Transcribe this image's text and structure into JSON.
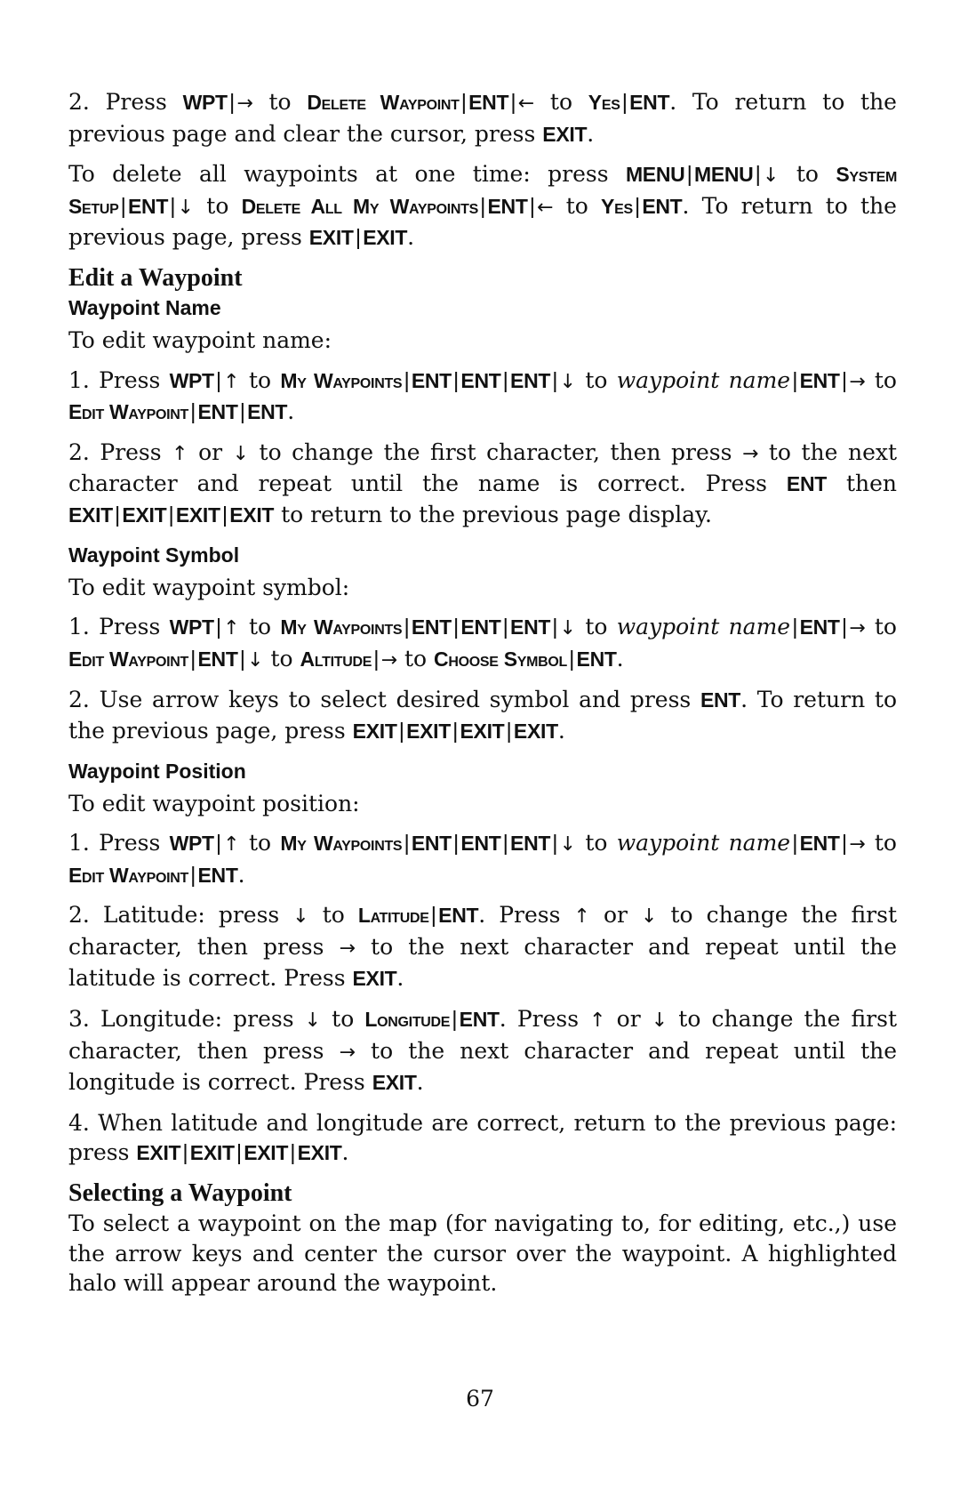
{
  "page_number": "67",
  "blocks": [
    {
      "type": "p",
      "runs": [
        [
          "t",
          "2. Press "
        ],
        [
          "k",
          "WPT"
        ],
        [
          "s"
        ],
        [
          "a",
          "→"
        ],
        [
          "t",
          " to "
        ],
        [
          "c",
          "Delete Waypoint"
        ],
        [
          "s"
        ],
        [
          "k",
          "ENT"
        ],
        [
          "s"
        ],
        [
          "a",
          "←"
        ],
        [
          "t",
          " to "
        ],
        [
          "c",
          "Yes"
        ],
        [
          "s"
        ],
        [
          "k",
          "ENT"
        ],
        [
          "t",
          ". To return to the previous page and clear the cursor, press "
        ],
        [
          "k",
          "EXIT"
        ],
        [
          "t",
          "."
        ]
      ]
    },
    {
      "type": "p",
      "runs": [
        [
          "t",
          "To delete all waypoints at one time: press "
        ],
        [
          "k",
          "MENU"
        ],
        [
          "s"
        ],
        [
          "k",
          "MENU"
        ],
        [
          "s"
        ],
        [
          "a",
          "↓"
        ],
        [
          "t",
          " to "
        ],
        [
          "c",
          "System Setup"
        ],
        [
          "s"
        ],
        [
          "k",
          "ENT"
        ],
        [
          "s"
        ],
        [
          "a",
          "↓"
        ],
        [
          "t",
          " to "
        ],
        [
          "c",
          "Delete All My Waypoints"
        ],
        [
          "s"
        ],
        [
          "k",
          "ENT"
        ],
        [
          "s"
        ],
        [
          "a",
          "←"
        ],
        [
          "t",
          " to "
        ],
        [
          "c",
          "Yes"
        ],
        [
          "s"
        ],
        [
          "k",
          "ENT"
        ],
        [
          "t",
          ". To return to the previous page, press "
        ],
        [
          "k",
          "EXIT"
        ],
        [
          "s"
        ],
        [
          "k",
          "EXIT"
        ],
        [
          "t",
          "."
        ]
      ]
    },
    {
      "type": "h2",
      "text": "Edit a Waypoint"
    },
    {
      "type": "h3",
      "text": "Waypoint Name"
    },
    {
      "type": "p",
      "runs": [
        [
          "t",
          "To edit waypoint name:"
        ]
      ]
    },
    {
      "type": "p",
      "runs": [
        [
          "t",
          "1. Press "
        ],
        [
          "k",
          "WPT"
        ],
        [
          "s"
        ],
        [
          "a",
          "↑"
        ],
        [
          "t",
          " to "
        ],
        [
          "c",
          "My Waypoints"
        ],
        [
          "s"
        ],
        [
          "k",
          "ENT"
        ],
        [
          "s"
        ],
        [
          "k",
          "ENT"
        ],
        [
          "s"
        ],
        [
          "k",
          "ENT"
        ],
        [
          "s"
        ],
        [
          "a",
          "↓"
        ],
        [
          "t",
          " to "
        ],
        [
          "i",
          "waypoint name"
        ],
        [
          "s"
        ],
        [
          "k",
          "ENT"
        ],
        [
          "s"
        ],
        [
          "a",
          "→"
        ],
        [
          "t",
          " to "
        ],
        [
          "c",
          "Edit Waypoint"
        ],
        [
          "s"
        ],
        [
          "k",
          "ENT"
        ],
        [
          "s"
        ],
        [
          "k",
          "ENT"
        ],
        [
          "t",
          "."
        ]
      ]
    },
    {
      "type": "p",
      "runs": [
        [
          "t",
          "2. Press "
        ],
        [
          "a",
          "↑"
        ],
        [
          "t",
          " or "
        ],
        [
          "a",
          "↓"
        ],
        [
          "t",
          " to change the first character, then press "
        ],
        [
          "a",
          "→"
        ],
        [
          "t",
          " to the next character and repeat until the name is correct. Press "
        ],
        [
          "k",
          "ENT"
        ],
        [
          "t",
          " then "
        ],
        [
          "k",
          "EXIT"
        ],
        [
          "s"
        ],
        [
          "k",
          "EXIT"
        ],
        [
          "s"
        ],
        [
          "k",
          "EXIT"
        ],
        [
          "s"
        ],
        [
          "k",
          "EXIT"
        ],
        [
          "t",
          " to return to the previous page display."
        ]
      ]
    },
    {
      "type": "h3",
      "text": "Waypoint Symbol"
    },
    {
      "type": "p",
      "runs": [
        [
          "t",
          "To edit waypoint symbol:"
        ]
      ]
    },
    {
      "type": "p",
      "runs": [
        [
          "t",
          "1. Press "
        ],
        [
          "k",
          "WPT"
        ],
        [
          "s"
        ],
        [
          "a",
          "↑"
        ],
        [
          "t",
          " to "
        ],
        [
          "c",
          "My Waypoints"
        ],
        [
          "s"
        ],
        [
          "k",
          "ENT"
        ],
        [
          "s"
        ],
        [
          "k",
          "ENT"
        ],
        [
          "s"
        ],
        [
          "k",
          "ENT"
        ],
        [
          "s"
        ],
        [
          "a",
          "↓"
        ],
        [
          "t",
          " to "
        ],
        [
          "i",
          "waypoint name"
        ],
        [
          "s"
        ],
        [
          "k",
          "ENT"
        ],
        [
          "s"
        ],
        [
          "a",
          "→"
        ],
        [
          "t",
          " to "
        ],
        [
          "c",
          "Edit Waypoint"
        ],
        [
          "s"
        ],
        [
          "k",
          "ENT"
        ],
        [
          "s"
        ],
        [
          "a",
          "↓"
        ],
        [
          "t",
          " to "
        ],
        [
          "c",
          "Altitude"
        ],
        [
          "s"
        ],
        [
          "a",
          "→"
        ],
        [
          "t",
          " to "
        ],
        [
          "c",
          "Choose Symbol"
        ],
        [
          "s"
        ],
        [
          "k",
          "ENT"
        ],
        [
          "t",
          "."
        ]
      ]
    },
    {
      "type": "p",
      "runs": [
        [
          "t",
          "2. Use arrow keys to select desired symbol and press "
        ],
        [
          "k",
          "ENT"
        ],
        [
          "t",
          ". To return to the previous page, press "
        ],
        [
          "k",
          "EXIT"
        ],
        [
          "s"
        ],
        [
          "k",
          "EXIT"
        ],
        [
          "s"
        ],
        [
          "k",
          "EXIT"
        ],
        [
          "s"
        ],
        [
          "k",
          "EXIT"
        ],
        [
          "t",
          "."
        ]
      ]
    },
    {
      "type": "h3",
      "text": "Waypoint Position"
    },
    {
      "type": "p",
      "runs": [
        [
          "t",
          "To edit waypoint position:"
        ]
      ]
    },
    {
      "type": "p",
      "runs": [
        [
          "t",
          "1. Press "
        ],
        [
          "k",
          "WPT"
        ],
        [
          "s"
        ],
        [
          "a",
          "↑"
        ],
        [
          "t",
          " to "
        ],
        [
          "c",
          "My Waypoints"
        ],
        [
          "s"
        ],
        [
          "k",
          "ENT"
        ],
        [
          "s"
        ],
        [
          "k",
          "ENT"
        ],
        [
          "s"
        ],
        [
          "k",
          "ENT"
        ],
        [
          "s"
        ],
        [
          "a",
          "↓"
        ],
        [
          "t",
          " to "
        ],
        [
          "i",
          "waypoint name"
        ],
        [
          "s"
        ],
        [
          "k",
          "ENT"
        ],
        [
          "s"
        ],
        [
          "a",
          "→"
        ],
        [
          "t",
          " to "
        ],
        [
          "c",
          "Edit Waypoint"
        ],
        [
          "s"
        ],
        [
          "k",
          "ENT"
        ],
        [
          "t",
          "."
        ]
      ]
    },
    {
      "type": "p",
      "runs": [
        [
          "t",
          "2. Latitude: press "
        ],
        [
          "a",
          "↓"
        ],
        [
          "t",
          " to "
        ],
        [
          "c",
          "Latitude"
        ],
        [
          "s"
        ],
        [
          "k",
          "ENT"
        ],
        [
          "t",
          ". Press "
        ],
        [
          "a",
          "↑"
        ],
        [
          "t",
          " or "
        ],
        [
          "a",
          "↓"
        ],
        [
          "t",
          " to change the first character, then press "
        ],
        [
          "a",
          "→"
        ],
        [
          "t",
          " to the next character and repeat until the latitude is correct. Press "
        ],
        [
          "k",
          "EXIT"
        ],
        [
          "t",
          "."
        ]
      ]
    },
    {
      "type": "p",
      "runs": [
        [
          "t",
          "3. Longitude: press "
        ],
        [
          "a",
          "↓"
        ],
        [
          "t",
          " to "
        ],
        [
          "c",
          "Longitude"
        ],
        [
          "s"
        ],
        [
          "k",
          "ENT"
        ],
        [
          "t",
          ". Press "
        ],
        [
          "a",
          "↑"
        ],
        [
          "t",
          " or "
        ],
        [
          "a",
          "↓"
        ],
        [
          "t",
          " to change the first character, then press "
        ],
        [
          "a",
          "→"
        ],
        [
          "t",
          " to the next character and repeat until the longitude is correct. Press "
        ],
        [
          "k",
          "EXIT"
        ],
        [
          "t",
          "."
        ]
      ]
    },
    {
      "type": "p",
      "runs": [
        [
          "t",
          "4. When latitude and longitude are correct, return to the previous page: press "
        ],
        [
          "k",
          "EXIT"
        ],
        [
          "s"
        ],
        [
          "k",
          "EXIT"
        ],
        [
          "s"
        ],
        [
          "k",
          "EXIT"
        ],
        [
          "s"
        ],
        [
          "k",
          "EXIT"
        ],
        [
          "t",
          "."
        ]
      ]
    },
    {
      "type": "h2",
      "text": "Selecting a Waypoint"
    },
    {
      "type": "p",
      "runs": [
        [
          "t",
          "To select a waypoint on the map (for navigating to, for editing, etc.,) use the arrow keys and center the cursor over the waypoint. A highlighted halo will appear around the waypoint."
        ]
      ]
    }
  ]
}
